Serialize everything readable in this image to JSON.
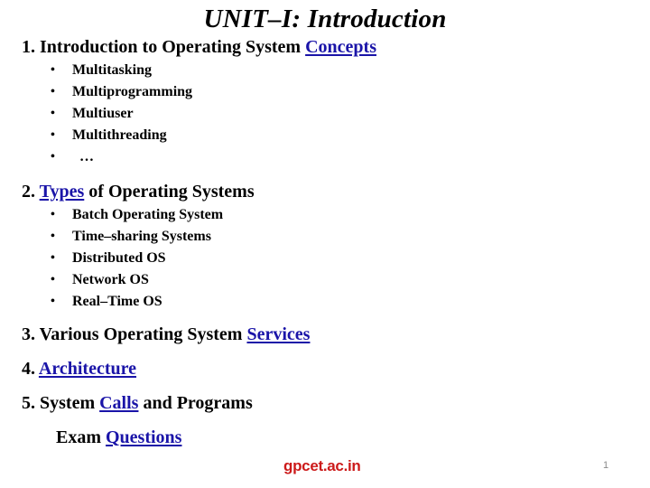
{
  "slide": {
    "title": "UNIT–I: Introduction",
    "sections": [
      {
        "prefix": "1. Introduction to Operating System ",
        "link": "Concepts",
        "suffix": "",
        "bullets": [
          "Multitasking",
          "Multiprogramming",
          "Multiuser",
          "Multithreading",
          "  …"
        ]
      },
      {
        "prefix": "2. ",
        "link": "Types",
        "suffix": " of Operating Systems",
        "bullets": [
          "Batch Operating System",
          "Time–sharing Systems",
          "Distributed OS",
          "Network OS",
          "Real–Time OS"
        ]
      },
      {
        "prefix": "3. Various Operating System ",
        "link": "Services",
        "suffix": ""
      },
      {
        "prefix": "4. ",
        "link": "Architecture",
        "suffix": ""
      },
      {
        "prefix": "5. System ",
        "link": "Calls",
        "suffix": " and Programs"
      },
      {
        "prefix": "Exam ",
        "link": "Questions",
        "suffix": ""
      }
    ],
    "bullet_glyph": "•",
    "footer": {
      "site": "gpcet.ac.in",
      "page_number": "1"
    },
    "colors": {
      "link": "#1a14a8",
      "footer_site": "#cc1a1a",
      "page_number": "#8a8a8a"
    }
  }
}
